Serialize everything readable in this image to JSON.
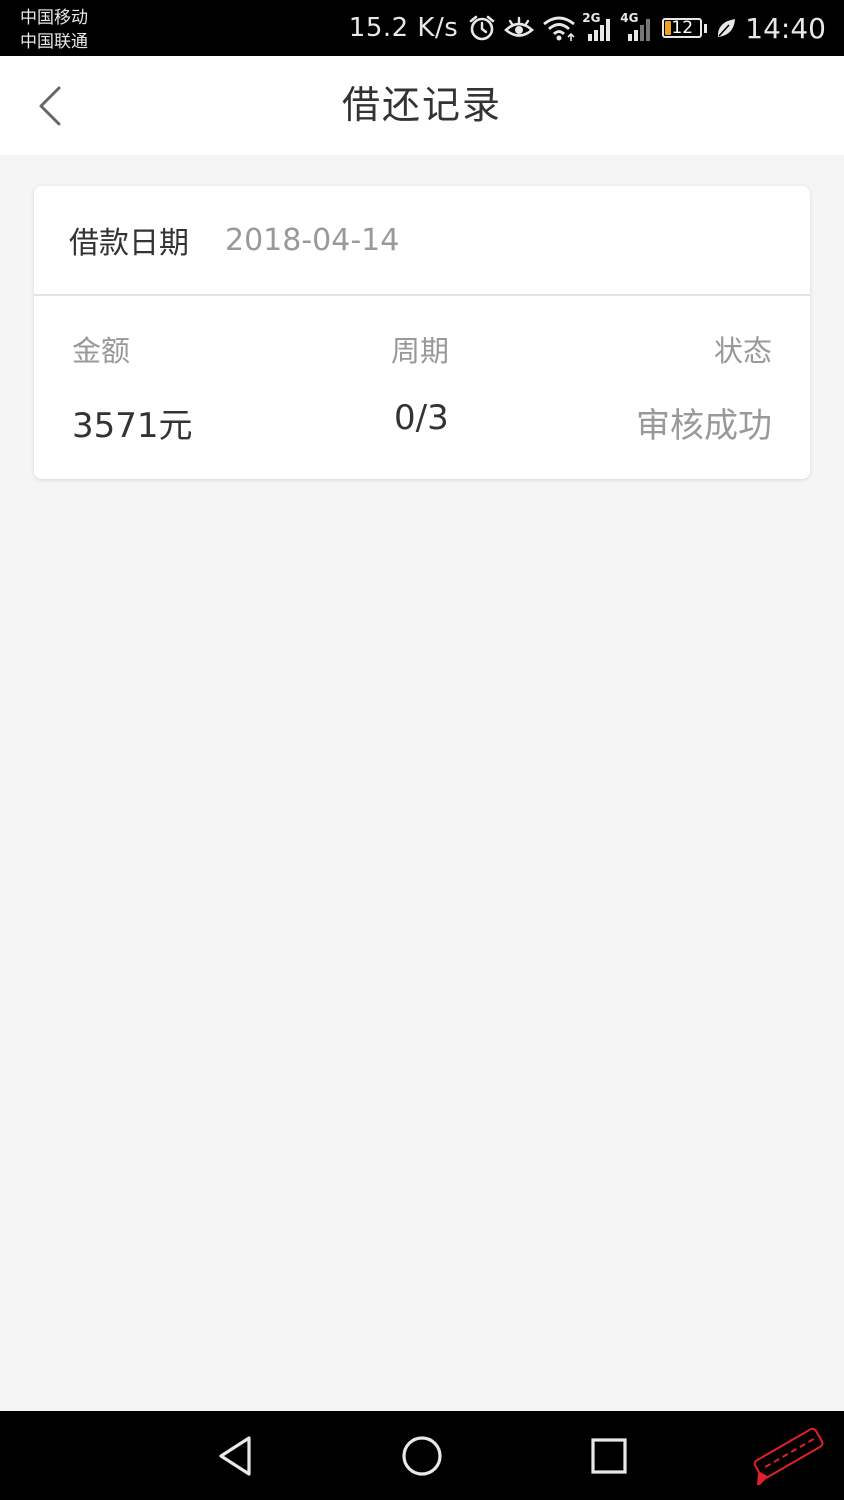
{
  "status_bar": {
    "carrier_1": "中国移动",
    "carrier_2": "中国联通",
    "net_speed": "15.2 K/s",
    "signal_1_label": "2G",
    "signal_2_label": "4G",
    "battery_level": "12",
    "time": "14:40",
    "icons": [
      "alarm-icon",
      "eye-comfort-icon",
      "wifi-icon",
      "signal-2g-icon",
      "signal-4g-icon",
      "battery-icon",
      "leaf-icon"
    ]
  },
  "header": {
    "title": "借还记录",
    "back_icon": "chevron-left-icon"
  },
  "record": {
    "date_label": "借款日期",
    "date_value": "2018-04-14",
    "amount_label": "金额",
    "amount_value": "3571元",
    "period_label": "周期",
    "period_value": "0/3",
    "status_label": "状态",
    "status_value": "审核成功"
  },
  "nav_bar": {
    "icons": [
      "nav-back-icon",
      "nav-home-icon",
      "nav-recents-icon"
    ]
  },
  "colors": {
    "page_bg": "#f5f5f5",
    "text_primary": "#333333",
    "text_secondary": "#999999",
    "battery_low": "#f0a020",
    "watermark": "#e0202a"
  }
}
